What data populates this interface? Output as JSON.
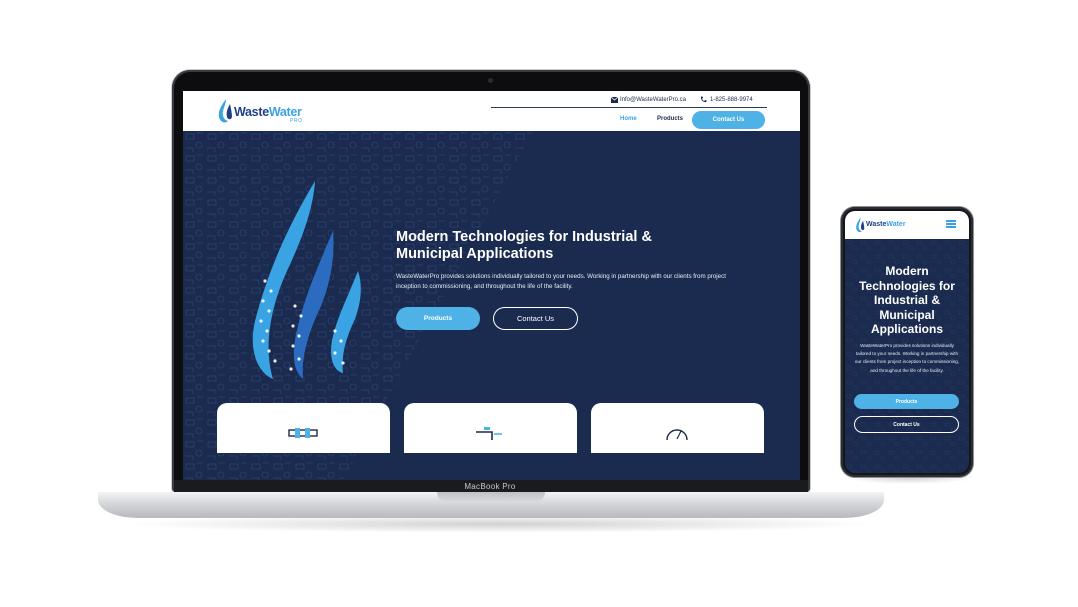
{
  "laptop": {
    "brand_label": "MacBook Pro"
  },
  "site": {
    "logo_text_main": "Waste",
    "logo_text_accent": "Water",
    "logo_subtext": "PRO",
    "header": {
      "email": "Info@WasteWaterPro.ca",
      "phone": "1-825-888-9974",
      "nav": {
        "home": "Home",
        "products": "Products",
        "contact": "Contact Us"
      }
    },
    "hero": {
      "title": "Modern Technologies for Industrial & Municipal Applications",
      "description": "WasteWaterPro provides solutions individually tailored to your needs. Working in partnership with our clients from project inception to commissioning, and throughout the life of the facility.",
      "btn_products": "Products",
      "btn_contact": "Contact Us"
    }
  },
  "mobile": {
    "logo_text_main": "Waste",
    "logo_text_accent": "Water",
    "title": "Modern Technologies for Industrial & Municipal Applications",
    "description": "WasteWaterPro provides solutions individually tailored to your needs. Working in partnership with our clients from project inception to commissioning, and throughout the life of the facility.",
    "btn_products": "Products",
    "btn_contact": "Contact Us"
  },
  "colors": {
    "navy": "#1b2b4f",
    "accent_blue": "#4fb2e6",
    "logo_dark": "#1f3f87"
  },
  "icons": [
    "mail-icon",
    "phone-icon",
    "hamburger-menu-icon",
    "water-drop-logo-icon",
    "pipe-icon",
    "faucet-icon",
    "gauge-icon"
  ]
}
